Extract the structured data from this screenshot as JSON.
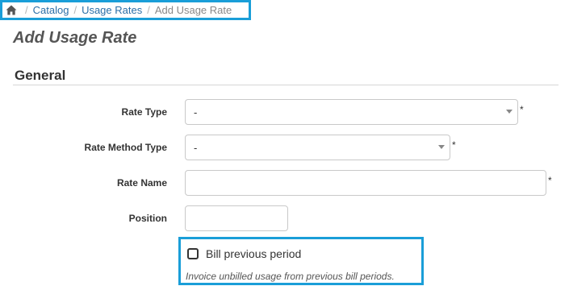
{
  "breadcrumb": {
    "home_icon": "home-icon",
    "items": [
      "Catalog",
      "Usage Rates"
    ],
    "current": "Add Usage Rate",
    "separator": "/"
  },
  "page": {
    "title": "Add Usage Rate"
  },
  "section": {
    "title": "General"
  },
  "form": {
    "rate_type": {
      "label": "Rate Type",
      "value": "-",
      "required": "*"
    },
    "rate_method_type": {
      "label": "Rate Method Type",
      "value": "-",
      "required": "*"
    },
    "rate_name": {
      "label": "Rate Name",
      "value": "",
      "required": "*"
    },
    "position": {
      "label": "Position",
      "value": ""
    },
    "bill_previous_period": {
      "label": "Bill previous period",
      "checked": false,
      "help": "Invoice unbilled usage from previous bill periods."
    }
  },
  "colors": {
    "highlight_border": "#1a9ed8",
    "link": "#2a6fa8"
  }
}
